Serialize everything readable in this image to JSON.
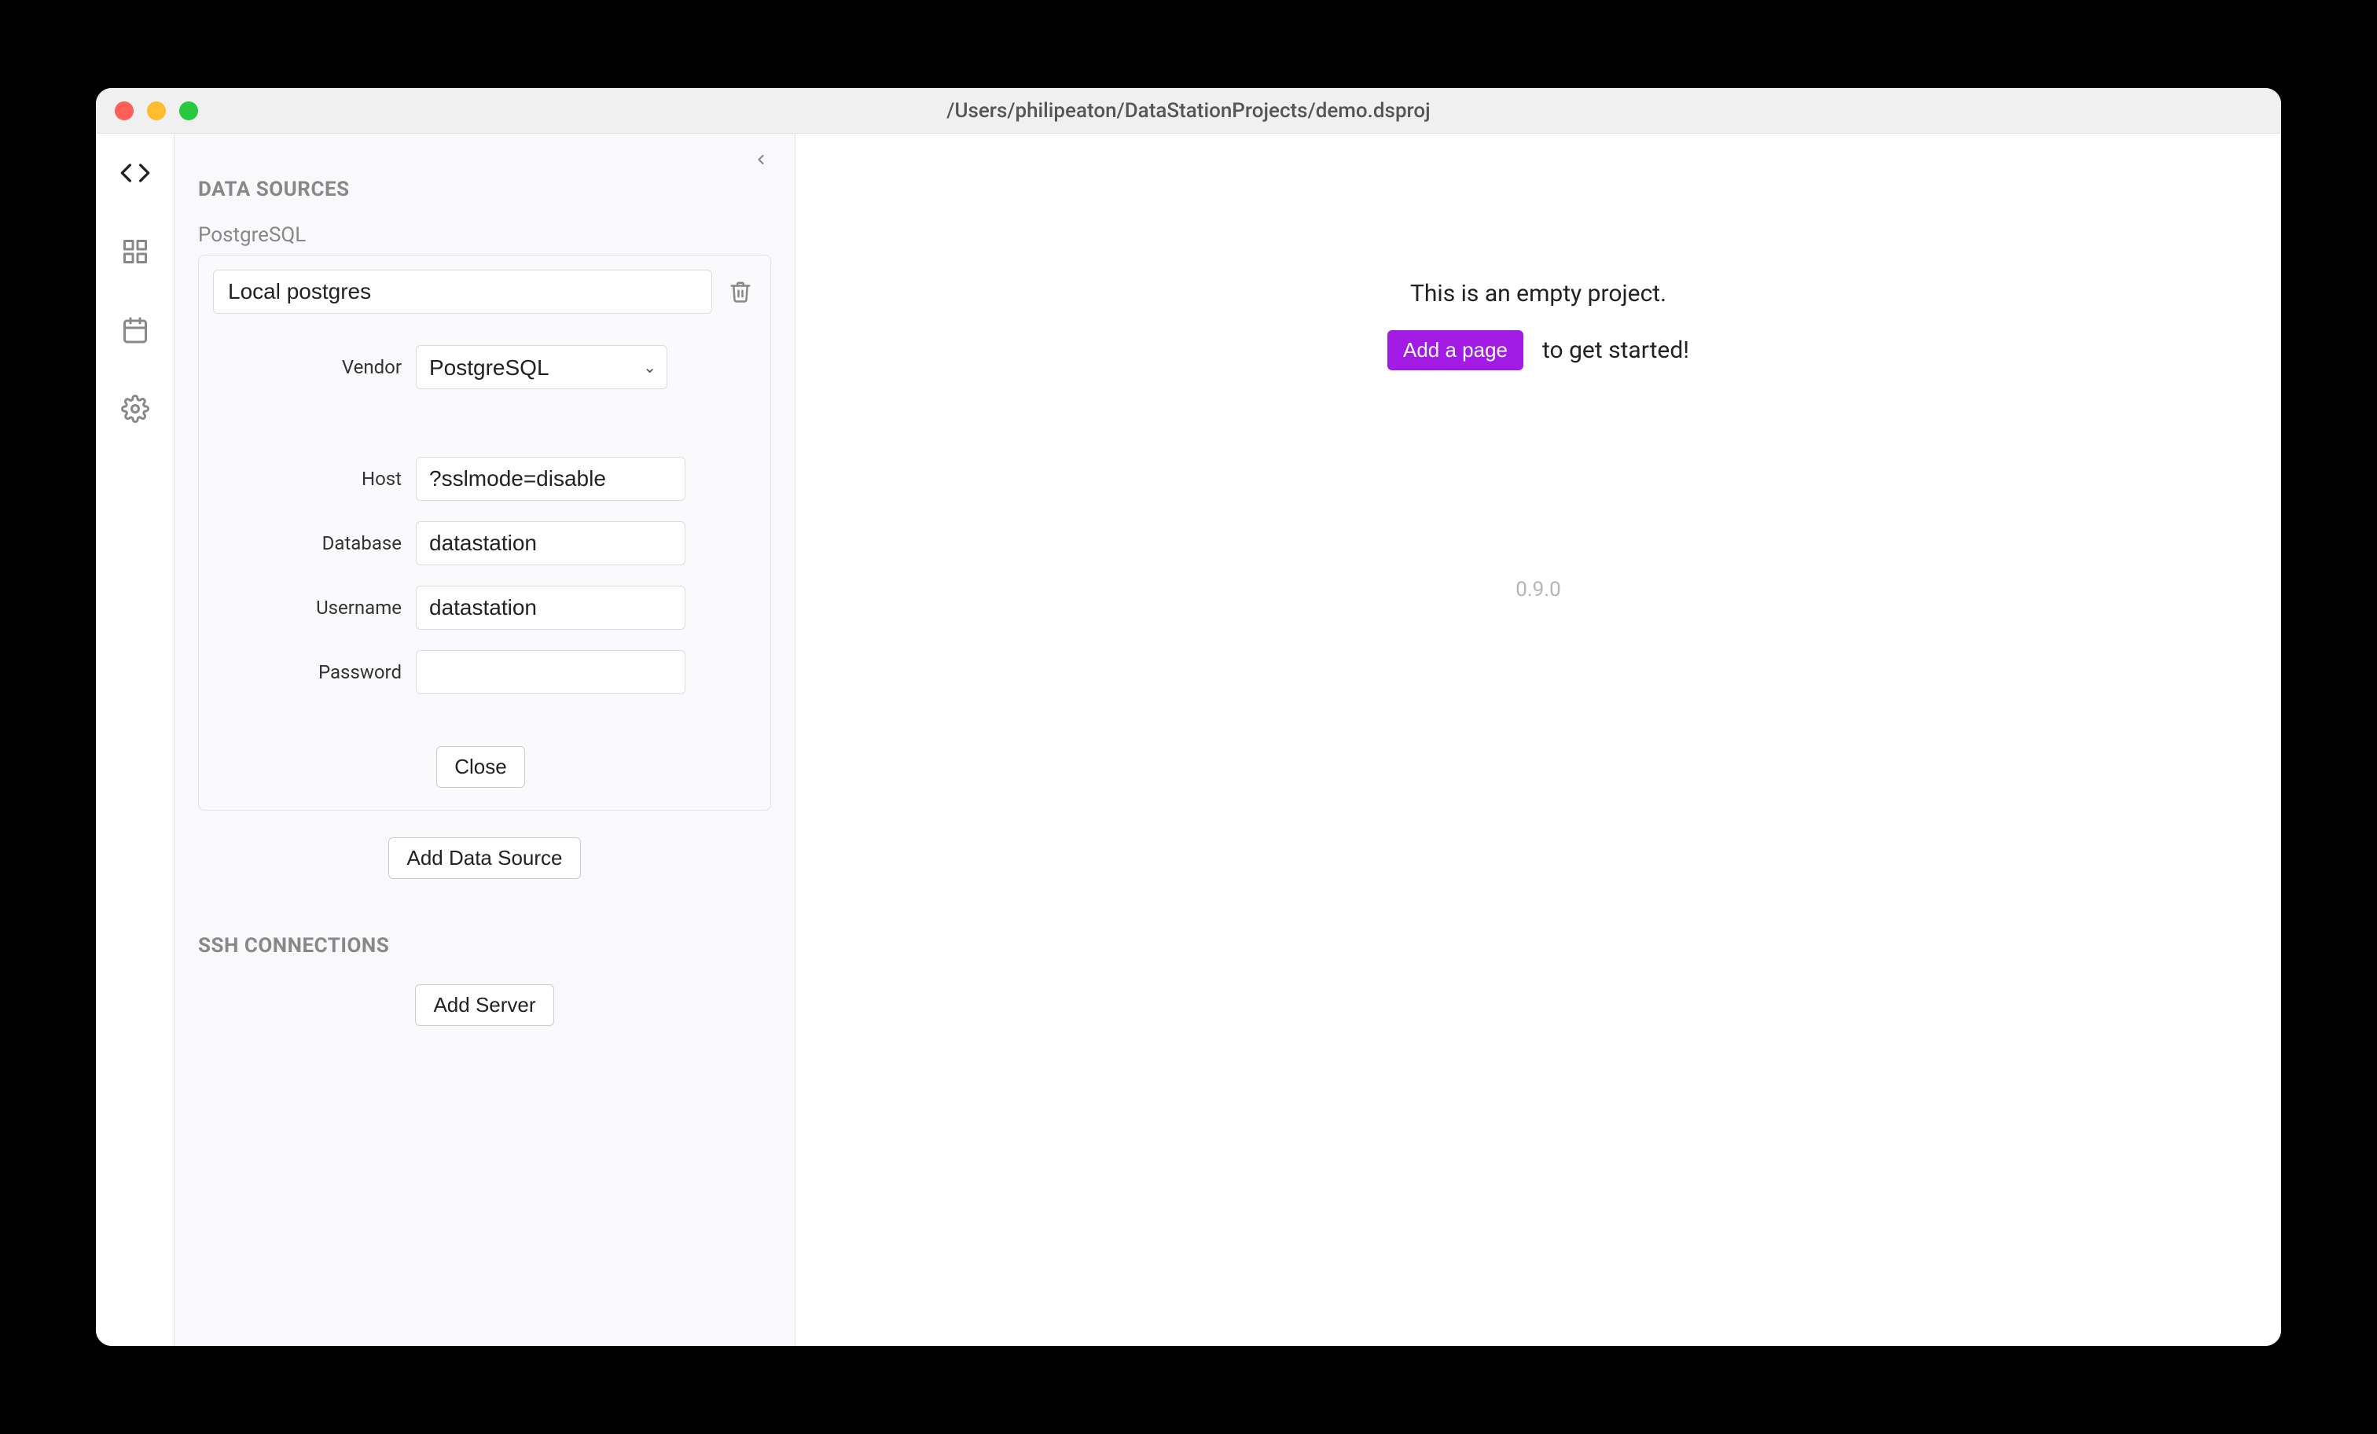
{
  "window": {
    "title": "/Users/philipeaton/DataStationProjects/demo.dsproj"
  },
  "sidebar": {
    "sections": {
      "data_sources": "DATA SOURCES",
      "ssh": "SSH CONNECTIONS"
    },
    "data_source": {
      "type_label": "PostgreSQL",
      "name": "Local postgres",
      "fields": {
        "vendor_label": "Vendor",
        "vendor_value": "PostgreSQL",
        "host_label": "Host",
        "host_value": "?sslmode=disable",
        "database_label": "Database",
        "database_value": "datastation",
        "username_label": "Username",
        "username_value": "datastation",
        "password_label": "Password",
        "password_value": ""
      },
      "close_label": "Close"
    },
    "add_data_source": "Add Data Source",
    "add_server": "Add Server"
  },
  "main": {
    "empty_text": "This is an empty project.",
    "add_page_label": "Add a page",
    "cta_suffix": "to get started!",
    "version": "0.9.0"
  }
}
